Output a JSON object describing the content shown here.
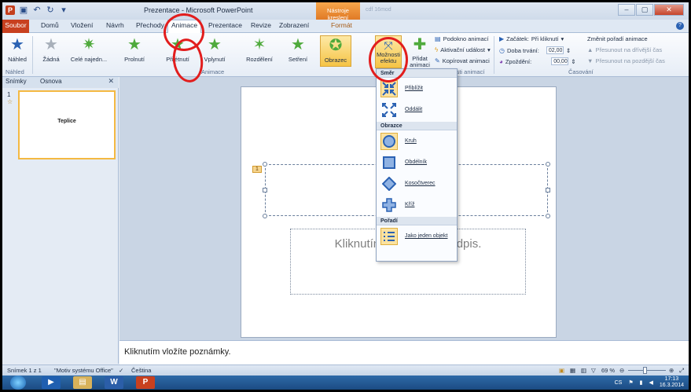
{
  "window": {
    "title": "Prezentace - Microsoft PowerPoint",
    "contextual_tab": "Nástroje kreslení",
    "blurred_title": "cdf 16mod"
  },
  "tabs": {
    "file": "Soubor",
    "items": [
      "Domů",
      "Vložení",
      "Návrh",
      "Přechody",
      "Animace",
      "Prezentace",
      "Revize",
      "Zobrazení",
      "Formát"
    ]
  },
  "ribbon": {
    "preview": "Náhled",
    "preview_group": "Náhled",
    "animations": [
      "Žádná",
      "Celé najedn...",
      "Prolnutí",
      "Přilétnutí",
      "Vplynutí",
      "Rozdělení",
      "Setření",
      "Obrazec"
    ],
    "animation_group": "Animace",
    "effect_options": "Možnosti efektu",
    "add_animation": "Přidat animaci",
    "animation_pane": "Podokno animací",
    "trigger": "Aktivační událost",
    "painter": "Kopírovat animaci",
    "advanced_group": "...nosti animací",
    "start_label": "Začátek:",
    "start_value": "Při kliknutí",
    "duration_label": "Doba trvání:",
    "duration_value": "02,00",
    "delay_label": "Zpoždění:",
    "delay_value": "00,00",
    "reorder_title": "Změnit pořadí animace",
    "move_earlier": "Přesunout na dřívější čas",
    "move_later": "Přesunout na pozdější čas",
    "timing_group": "Časování"
  },
  "left_pane": {
    "tab_slides": "Snímky",
    "tab_outline": "Osnova",
    "slide_number": "1",
    "thumb_title": "Teplice"
  },
  "slide": {
    "anim_tag": "1",
    "subtitle_placeholder": "Kliknutím vložíte podnadpis.",
    "notes": "Kliknutím vložíte poznámky."
  },
  "dropdown": {
    "section_direction": "Směr",
    "direction_items": [
      "Přiblížit",
      "Oddálit"
    ],
    "section_shapes": "Obrazce",
    "shape_items": [
      "Kruh",
      "Obdélník",
      "Kosočtverec",
      "Kříž"
    ],
    "section_sequence": "Pořadí",
    "sequence_items": [
      "Jako jeden objekt"
    ]
  },
  "status": {
    "slide_info": "Snímek 1 z 1",
    "theme": "\"Motiv systému Office\"",
    "language": "Čeština",
    "zoom": "69 %"
  },
  "taskbar": {
    "tray_lang": "CS",
    "time": "17:13",
    "date": "16.3.2014"
  },
  "colors": {
    "annotation": "#e21d1d",
    "file_tab": "#c8401f",
    "contextual_tab": "#e07a26",
    "selected_highlight": "#f6c445"
  }
}
